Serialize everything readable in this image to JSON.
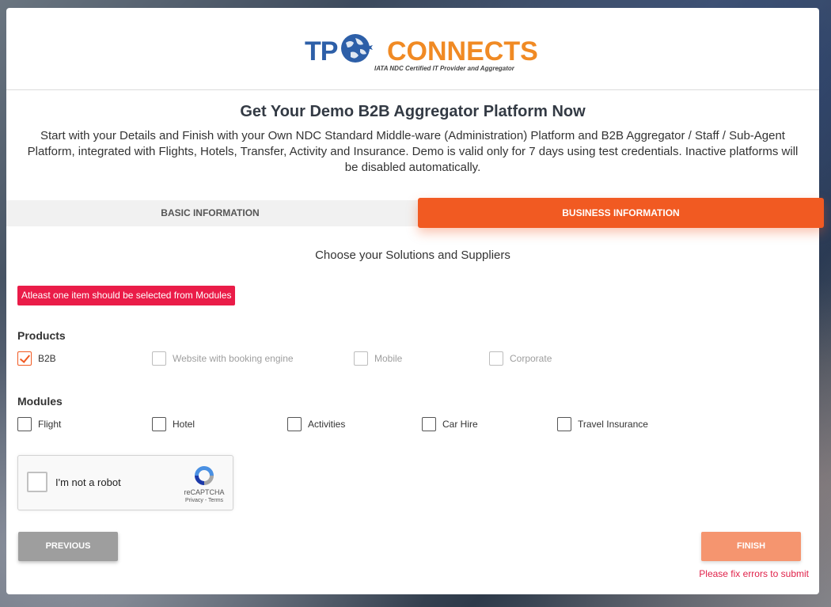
{
  "logo": {
    "left_text": "TP",
    "right_text": "CONNECTS",
    "tagline": "IATA NDC Certified IT Provider and Aggregator"
  },
  "title": "Get Your Demo B2B Aggregator Platform Now",
  "description": "Start with your Details and Finish with your Own NDC Standard Middle-ware (Administration) Platform and B2B Aggregator / Staff / Sub-Agent Platform, integrated with Flights, Hotels, Transfer, Activity and Insurance. Demo is valid only for 7 days using test credentials. Inactive platforms will be disabled automatically.",
  "tabs": [
    {
      "label": "BASIC INFORMATION",
      "active": false
    },
    {
      "label": "BUSINESS INFORMATION",
      "active": true
    }
  ],
  "subtitle": "Choose your Solutions and Suppliers",
  "error_message": "Atleast one item should be selected from Modules",
  "products": {
    "label": "Products",
    "items": [
      {
        "label": "B2B",
        "checked": true,
        "disabled": false
      },
      {
        "label": "Website with booking engine",
        "checked": false,
        "disabled": true
      },
      {
        "label": "Mobile",
        "checked": false,
        "disabled": true
      },
      {
        "label": "Corporate",
        "checked": false,
        "disabled": true
      }
    ]
  },
  "modules": {
    "label": "Modules",
    "items": [
      {
        "label": "Flight",
        "checked": false
      },
      {
        "label": "Hotel",
        "checked": false
      },
      {
        "label": "Activities",
        "checked": false
      },
      {
        "label": "Car Hire",
        "checked": false
      },
      {
        "label": "Travel Insurance",
        "checked": false
      }
    ]
  },
  "recaptcha": {
    "label": "I'm not a robot",
    "brand": "reCAPTCHA",
    "links": "Privacy - Terms"
  },
  "buttons": {
    "previous": "PREVIOUS",
    "finish": "FINISH"
  },
  "fix_errors": "Please fix errors to submit",
  "colors": {
    "accent": "#f15a22",
    "error": "#ea1c48",
    "brand_blue": "#2d5fa8",
    "brand_orange": "#f08a24"
  }
}
